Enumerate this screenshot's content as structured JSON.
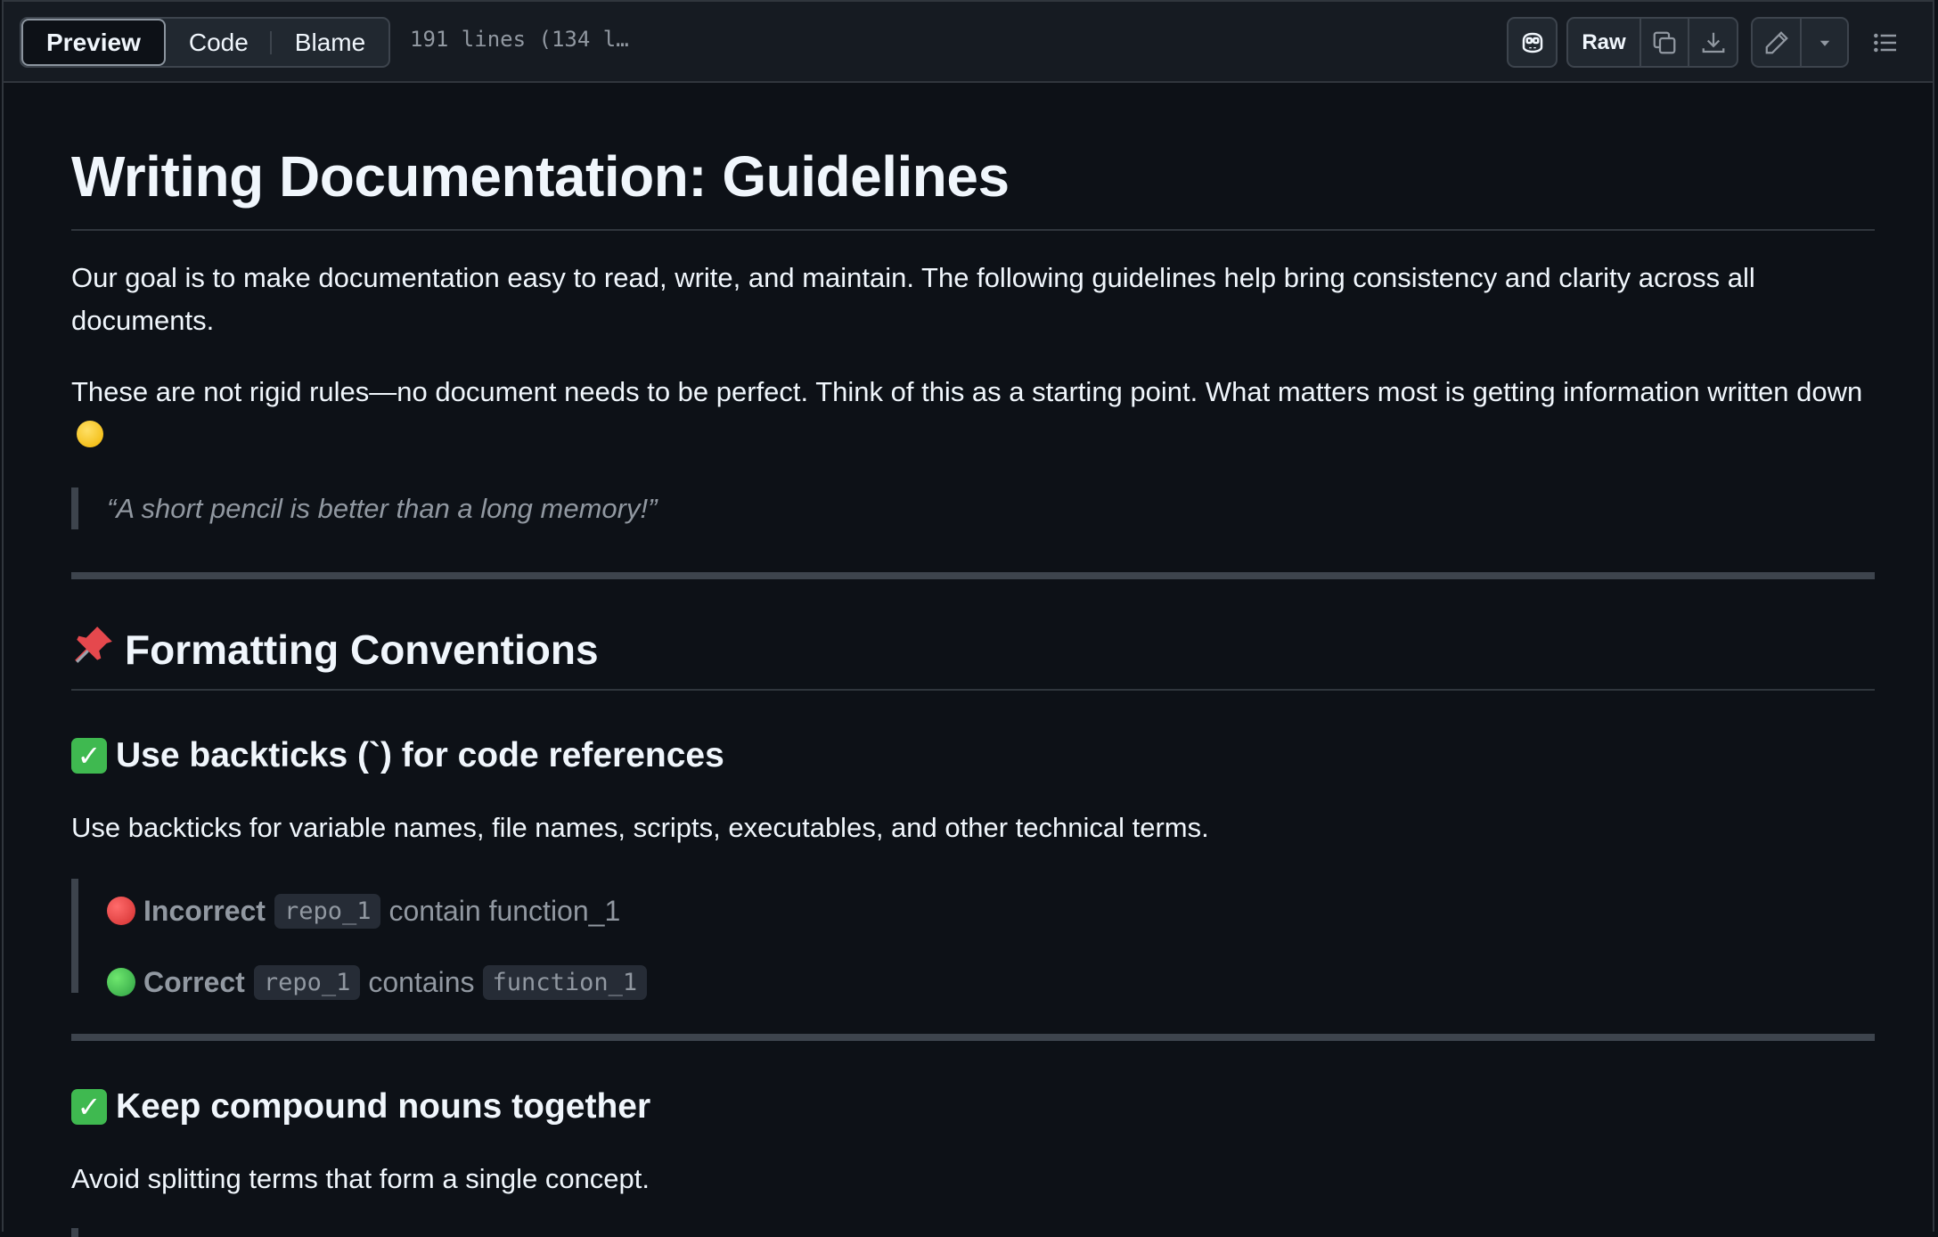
{
  "toolbar": {
    "tabs": [
      "Preview",
      "Code",
      "Blame"
    ],
    "file_info": "191 lines (134 l…",
    "raw_label": "Raw",
    "icons": [
      "copilot-icon",
      "copy-icon",
      "download-icon",
      "pencil-icon",
      "triangle-down-icon",
      "list-unordered-icon"
    ]
  },
  "doc": {
    "title": "Writing Documentation: Guidelines",
    "intro_1": "Our goal is to make documentation easy to read, write, and maintain. The following guidelines help bring consistency and clarity across all documents.",
    "intro_2": "These are not rigid rules—no document needs to be perfect. Think of this as a starting point. What matters most is getting information written down",
    "quote": "“A short pencil is better than a long memory!”",
    "section_1": {
      "emoji": "📌",
      "title": "Formatting Conventions"
    },
    "subsection_1": {
      "emoji": "✅",
      "title": "Use backticks (`) for code references",
      "body": "Use backticks for variable names, file names, scripts, executables, and other technical terms.",
      "incorrect": {
        "label": "Incorrect",
        "code": "repo_1",
        "rest": "contain function_1"
      },
      "correct": {
        "label": "Correct",
        "code_1": "repo_1",
        "middle": "contains",
        "code_2": "function_1"
      }
    },
    "subsection_2": {
      "emoji": "✅",
      "title": "Keep compound nouns together",
      "body": "Avoid splitting terms that form a single concept."
    }
  },
  "colors": {
    "background": "#0d1117",
    "toolbar": "#161b22",
    "border": "#30363d",
    "text": "#f0f6fc",
    "muted": "#9198a1",
    "check_green": "#3fb950"
  }
}
